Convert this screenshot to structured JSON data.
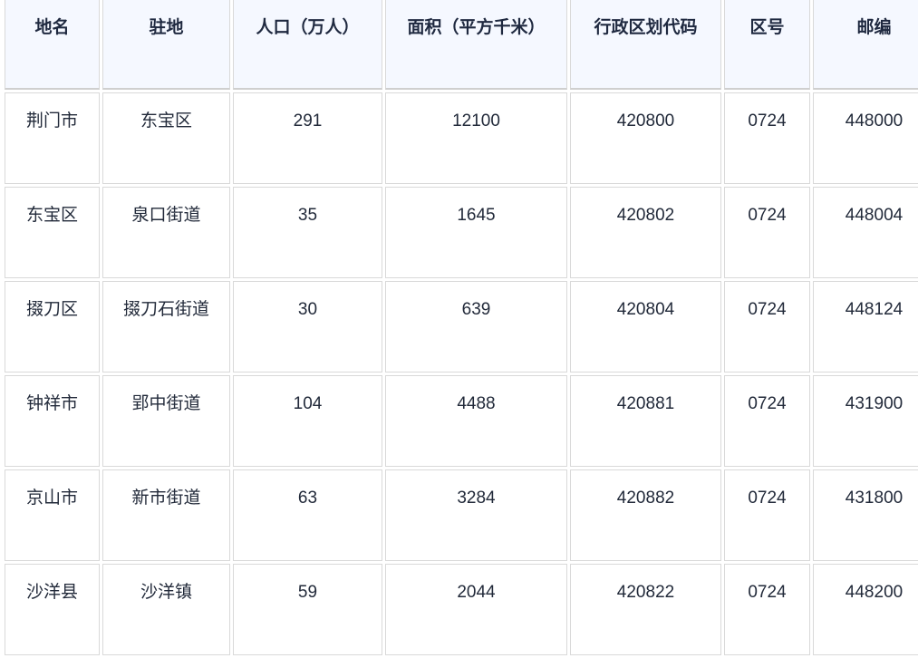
{
  "table": {
    "headers": [
      "地名",
      "驻地",
      "人口（万人）",
      "面积（平方千米）",
      "行政区划代码",
      "区号",
      "邮编"
    ],
    "rows": [
      [
        "荆门市",
        "东宝区",
        "291",
        "12100",
        "420800",
        "0724",
        "448000"
      ],
      [
        "东宝区",
        "泉口街道",
        "35",
        "1645",
        "420802",
        "0724",
        "448004"
      ],
      [
        "掇刀区",
        "掇刀石街道",
        "30",
        "639",
        "420804",
        "0724",
        "448124"
      ],
      [
        "钟祥市",
        "郢中街道",
        "104",
        "4488",
        "420881",
        "0724",
        "431900"
      ],
      [
        "京山市",
        "新市街道",
        "63",
        "3284",
        "420882",
        "0724",
        "431800"
      ],
      [
        "沙洋县",
        "沙洋镇",
        "59",
        "2044",
        "420822",
        "0724",
        "448200"
      ]
    ]
  }
}
